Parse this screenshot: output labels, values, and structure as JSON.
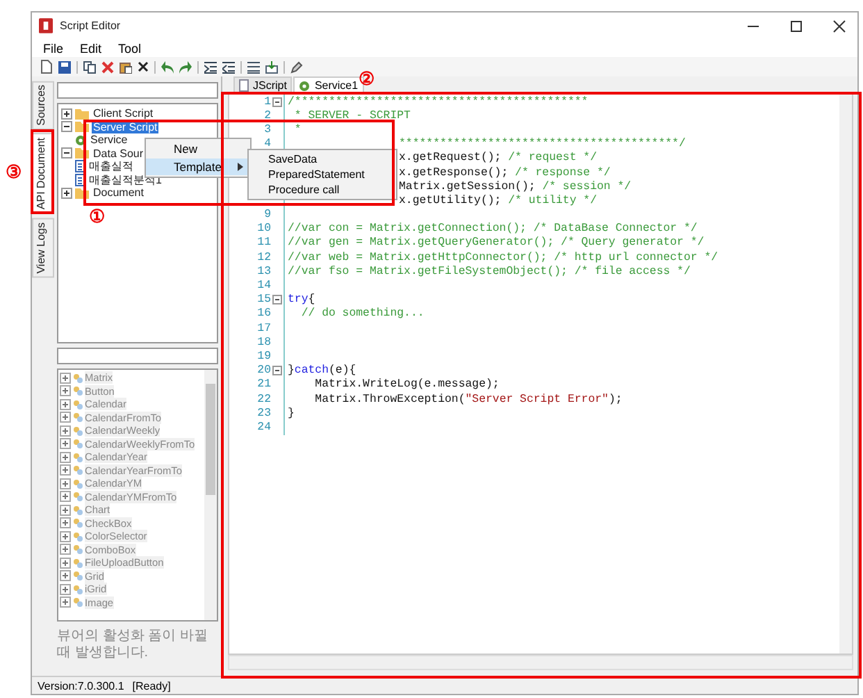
{
  "window": {
    "title": "Script Editor"
  },
  "menu": [
    "File",
    "Edit",
    "Tool"
  ],
  "side_tabs": [
    {
      "label": "Sources",
      "selected": false
    },
    {
      "label": "API Document",
      "selected": true
    },
    {
      "label": "View Logs",
      "selected": false
    }
  ],
  "tree": [
    {
      "label": "Client Script",
      "kind": "folder",
      "expanded": false,
      "selected": false
    },
    {
      "label": "Server Script",
      "kind": "folder",
      "expanded": true,
      "selected": true,
      "children": [
        {
          "label": "Service",
          "kind": "service",
          "selected": false
        }
      ]
    },
    {
      "label": "Data Sour",
      "kind": "folder",
      "expanded": true,
      "selected": false,
      "children": [
        {
          "label": "매출실적",
          "kind": "data",
          "selected": false
        },
        {
          "label": "매출실적분석1",
          "kind": "data",
          "selected": false
        }
      ]
    },
    {
      "label": "Document",
      "kind": "folder",
      "expanded": false,
      "selected": false
    }
  ],
  "context_menu": [
    {
      "label": "New",
      "selected": false
    },
    {
      "label": "Template",
      "selected": true,
      "submenu": true
    }
  ],
  "submenu": [
    "SaveData",
    "PreparedStatement",
    "Procedure call"
  ],
  "components": [
    "Matrix",
    "Button",
    "Calendar",
    "CalendarFromTo",
    "CalendarWeekly",
    "CalendarWeeklyFromTo",
    "CalendarYear",
    "CalendarYearFromTo",
    "CalendarYM",
    "CalendarYMFromTo",
    "Chart",
    "CheckBox",
    "ColorSelector",
    "ComboBox",
    "FileUploadButton",
    "Grid",
    "iGrid",
    "Image"
  ],
  "description": "뷰어의 활성화 폼이 바뀔때 발생합니다.",
  "editor_tabs": [
    {
      "label": "JScript",
      "selected": false
    },
    {
      "label": "Service1",
      "selected": true
    }
  ],
  "code": [
    {
      "n": "1",
      "fold": true,
      "kind": "normal",
      "segs": [
        {
          "t": "/*******************************************",
          "kind": "comment"
        }
      ]
    },
    {
      "n": "2",
      "kind": "normal",
      "segs": [
        {
          "t": " * SERVER - SCRIPT",
          "kind": "comment"
        }
      ]
    },
    {
      "n": "3",
      "kind": "normal",
      "segs": [
        {
          "t": " *",
          "kind": "comment"
        }
      ]
    },
    {
      "n": "4",
      "kind": "covered",
      "segs": [
        {
          "t": "*****************************************/",
          "kind": "comment"
        }
      ]
    },
    {
      "kind": "covered",
      "segs": [
        {
          "t": "x.getRequest(); ",
          "kind": "plain"
        },
        {
          "t": "/* request */",
          "kind": "comment"
        }
      ]
    },
    {
      "kind": "covered",
      "segs": [
        {
          "t": "x.getResponse(); ",
          "kind": "plain"
        },
        {
          "t": "/* response */",
          "kind": "comment"
        }
      ]
    },
    {
      "kind": "covered",
      "segs": [
        {
          "t": "Matrix.getSession(); ",
          "kind": "plain"
        },
        {
          "t": "/* session */",
          "kind": "comment"
        }
      ]
    },
    {
      "kind": "covered",
      "segs": [
        {
          "t": "x.getUtility(); ",
          "kind": "plain"
        },
        {
          "t": "/* utility */",
          "kind": "comment"
        }
      ]
    },
    {
      "n": "9",
      "kind": "normal"
    },
    {
      "n": "10",
      "kind": "normal",
      "segs": [
        {
          "t": "//var con = Matrix.getConnection(); /* DataBase Connector */",
          "kind": "comment"
        }
      ]
    },
    {
      "n": "11",
      "kind": "normal",
      "segs": [
        {
          "t": "//var gen = Matrix.getQueryGenerator(); /* Query generator */",
          "kind": "comment"
        }
      ]
    },
    {
      "n": "12",
      "kind": "normal",
      "segs": [
        {
          "t": "//var web = Matrix.getHttpConnector(); /* http url connector */",
          "kind": "comment"
        }
      ]
    },
    {
      "n": "13",
      "kind": "normal",
      "segs": [
        {
          "t": "//var fso = Matrix.getFileSystemObject(); /* file access */",
          "kind": "comment"
        }
      ]
    },
    {
      "n": "14",
      "kind": "normal"
    },
    {
      "n": "15",
      "fold": true,
      "kind": "normal",
      "segs": [
        {
          "t": "try",
          "kind": "keyword"
        },
        {
          "t": "{",
          "kind": "plain"
        }
      ]
    },
    {
      "n": "16",
      "kind": "normal",
      "segs": [
        {
          "t": "  // do something...",
          "kind": "comment"
        }
      ]
    },
    {
      "n": "17",
      "kind": "normal"
    },
    {
      "n": "18",
      "kind": "normal"
    },
    {
      "n": "19",
      "kind": "normal"
    },
    {
      "n": "20",
      "fold": true,
      "kind": "normal",
      "segs": [
        {
          "t": "}",
          "kind": "plain"
        },
        {
          "t": "catch",
          "kind": "keyword"
        },
        {
          "t": "(e){",
          "kind": "plain"
        }
      ]
    },
    {
      "n": "21",
      "kind": "normal",
      "segs": [
        {
          "t": "    Matrix.WriteLog(e.message);",
          "kind": "plain"
        }
      ]
    },
    {
      "n": "22",
      "kind": "normal",
      "segs": [
        {
          "t": "    Matrix.ThrowException(",
          "kind": "plain"
        },
        {
          "t": "\"Server Script Error\"",
          "kind": "string"
        },
        {
          "t": ");",
          "kind": "plain"
        }
      ]
    },
    {
      "n": "23",
      "kind": "normal",
      "segs": [
        {
          "t": "}",
          "kind": "plain"
        }
      ]
    },
    {
      "n": "24",
      "kind": "normal"
    }
  ],
  "status_bar": {
    "version": "Version:7.0.300.1",
    "state": "[Ready]"
  },
  "annotations": [
    "①",
    "②",
    "③"
  ]
}
